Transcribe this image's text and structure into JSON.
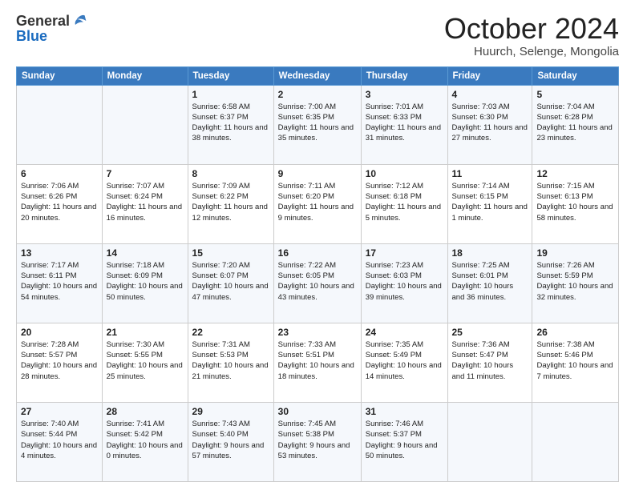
{
  "header": {
    "logo_general": "General",
    "logo_blue": "Blue",
    "month_title": "October 2024",
    "location": "Huurch, Selenge, Mongolia"
  },
  "days_of_week": [
    "Sunday",
    "Monday",
    "Tuesday",
    "Wednesday",
    "Thursday",
    "Friday",
    "Saturday"
  ],
  "weeks": [
    [
      {
        "day": "",
        "content": ""
      },
      {
        "day": "",
        "content": ""
      },
      {
        "day": "1",
        "content": "Sunrise: 6:58 AM\nSunset: 6:37 PM\nDaylight: 11 hours and 38 minutes."
      },
      {
        "day": "2",
        "content": "Sunrise: 7:00 AM\nSunset: 6:35 PM\nDaylight: 11 hours and 35 minutes."
      },
      {
        "day": "3",
        "content": "Sunrise: 7:01 AM\nSunset: 6:33 PM\nDaylight: 11 hours and 31 minutes."
      },
      {
        "day": "4",
        "content": "Sunrise: 7:03 AM\nSunset: 6:30 PM\nDaylight: 11 hours and 27 minutes."
      },
      {
        "day": "5",
        "content": "Sunrise: 7:04 AM\nSunset: 6:28 PM\nDaylight: 11 hours and 23 minutes."
      }
    ],
    [
      {
        "day": "6",
        "content": "Sunrise: 7:06 AM\nSunset: 6:26 PM\nDaylight: 11 hours and 20 minutes."
      },
      {
        "day": "7",
        "content": "Sunrise: 7:07 AM\nSunset: 6:24 PM\nDaylight: 11 hours and 16 minutes."
      },
      {
        "day": "8",
        "content": "Sunrise: 7:09 AM\nSunset: 6:22 PM\nDaylight: 11 hours and 12 minutes."
      },
      {
        "day": "9",
        "content": "Sunrise: 7:11 AM\nSunset: 6:20 PM\nDaylight: 11 hours and 9 minutes."
      },
      {
        "day": "10",
        "content": "Sunrise: 7:12 AM\nSunset: 6:18 PM\nDaylight: 11 hours and 5 minutes."
      },
      {
        "day": "11",
        "content": "Sunrise: 7:14 AM\nSunset: 6:15 PM\nDaylight: 11 hours and 1 minute."
      },
      {
        "day": "12",
        "content": "Sunrise: 7:15 AM\nSunset: 6:13 PM\nDaylight: 10 hours and 58 minutes."
      }
    ],
    [
      {
        "day": "13",
        "content": "Sunrise: 7:17 AM\nSunset: 6:11 PM\nDaylight: 10 hours and 54 minutes."
      },
      {
        "day": "14",
        "content": "Sunrise: 7:18 AM\nSunset: 6:09 PM\nDaylight: 10 hours and 50 minutes."
      },
      {
        "day": "15",
        "content": "Sunrise: 7:20 AM\nSunset: 6:07 PM\nDaylight: 10 hours and 47 minutes."
      },
      {
        "day": "16",
        "content": "Sunrise: 7:22 AM\nSunset: 6:05 PM\nDaylight: 10 hours and 43 minutes."
      },
      {
        "day": "17",
        "content": "Sunrise: 7:23 AM\nSunset: 6:03 PM\nDaylight: 10 hours and 39 minutes."
      },
      {
        "day": "18",
        "content": "Sunrise: 7:25 AM\nSunset: 6:01 PM\nDaylight: 10 hours and 36 minutes."
      },
      {
        "day": "19",
        "content": "Sunrise: 7:26 AM\nSunset: 5:59 PM\nDaylight: 10 hours and 32 minutes."
      }
    ],
    [
      {
        "day": "20",
        "content": "Sunrise: 7:28 AM\nSunset: 5:57 PM\nDaylight: 10 hours and 28 minutes."
      },
      {
        "day": "21",
        "content": "Sunrise: 7:30 AM\nSunset: 5:55 PM\nDaylight: 10 hours and 25 minutes."
      },
      {
        "day": "22",
        "content": "Sunrise: 7:31 AM\nSunset: 5:53 PM\nDaylight: 10 hours and 21 minutes."
      },
      {
        "day": "23",
        "content": "Sunrise: 7:33 AM\nSunset: 5:51 PM\nDaylight: 10 hours and 18 minutes."
      },
      {
        "day": "24",
        "content": "Sunrise: 7:35 AM\nSunset: 5:49 PM\nDaylight: 10 hours and 14 minutes."
      },
      {
        "day": "25",
        "content": "Sunrise: 7:36 AM\nSunset: 5:47 PM\nDaylight: 10 hours and 11 minutes."
      },
      {
        "day": "26",
        "content": "Sunrise: 7:38 AM\nSunset: 5:46 PM\nDaylight: 10 hours and 7 minutes."
      }
    ],
    [
      {
        "day": "27",
        "content": "Sunrise: 7:40 AM\nSunset: 5:44 PM\nDaylight: 10 hours and 4 minutes."
      },
      {
        "day": "28",
        "content": "Sunrise: 7:41 AM\nSunset: 5:42 PM\nDaylight: 10 hours and 0 minutes."
      },
      {
        "day": "29",
        "content": "Sunrise: 7:43 AM\nSunset: 5:40 PM\nDaylight: 9 hours and 57 minutes."
      },
      {
        "day": "30",
        "content": "Sunrise: 7:45 AM\nSunset: 5:38 PM\nDaylight: 9 hours and 53 minutes."
      },
      {
        "day": "31",
        "content": "Sunrise: 7:46 AM\nSunset: 5:37 PM\nDaylight: 9 hours and 50 minutes."
      },
      {
        "day": "",
        "content": ""
      },
      {
        "day": "",
        "content": ""
      }
    ]
  ]
}
